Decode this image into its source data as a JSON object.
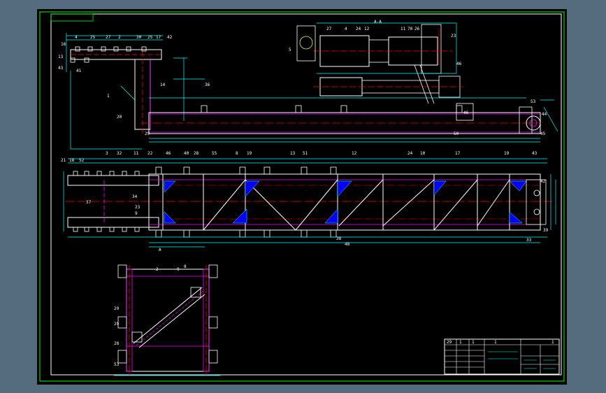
{
  "drawing": {
    "top_view_labels": [
      "16",
      "4",
      "25",
      "27",
      "2",
      "30",
      "25",
      "17",
      "42",
      "13",
      "43",
      "41",
      "1",
      "20",
      "29",
      "14",
      "36",
      "50",
      "46",
      "53",
      "44",
      "45"
    ],
    "front_view_labels": [
      "21",
      "18",
      "52",
      "3",
      "32",
      "11",
      "22",
      "46",
      "40",
      "28",
      "55",
      "8",
      "19",
      "13",
      "51",
      "12",
      "24",
      "10",
      "17",
      "19",
      "43",
      "42",
      "37",
      "34",
      "23",
      "9",
      "33",
      "38",
      "48",
      "39"
    ],
    "section_view_labels": [
      "2",
      "9",
      "29",
      "29",
      "28",
      "53",
      "8"
    ],
    "detail_view_labels": [
      "27",
      "4",
      "24",
      "12",
      "11",
      "70",
      "26",
      "23",
      "46",
      "5"
    ],
    "view_marks": [
      "A",
      "A-A"
    ],
    "title_block_cells": [
      "29",
      "1",
      "1",
      "1",
      "1"
    ]
  },
  "colors": {
    "frame": "#00ff00",
    "outline": "#ffffff",
    "dimension": "#00ffff",
    "centerline": "#ff0000",
    "hidden": "#ff00ff",
    "hatch": "#0000ff",
    "yellow": "#ffff00"
  }
}
